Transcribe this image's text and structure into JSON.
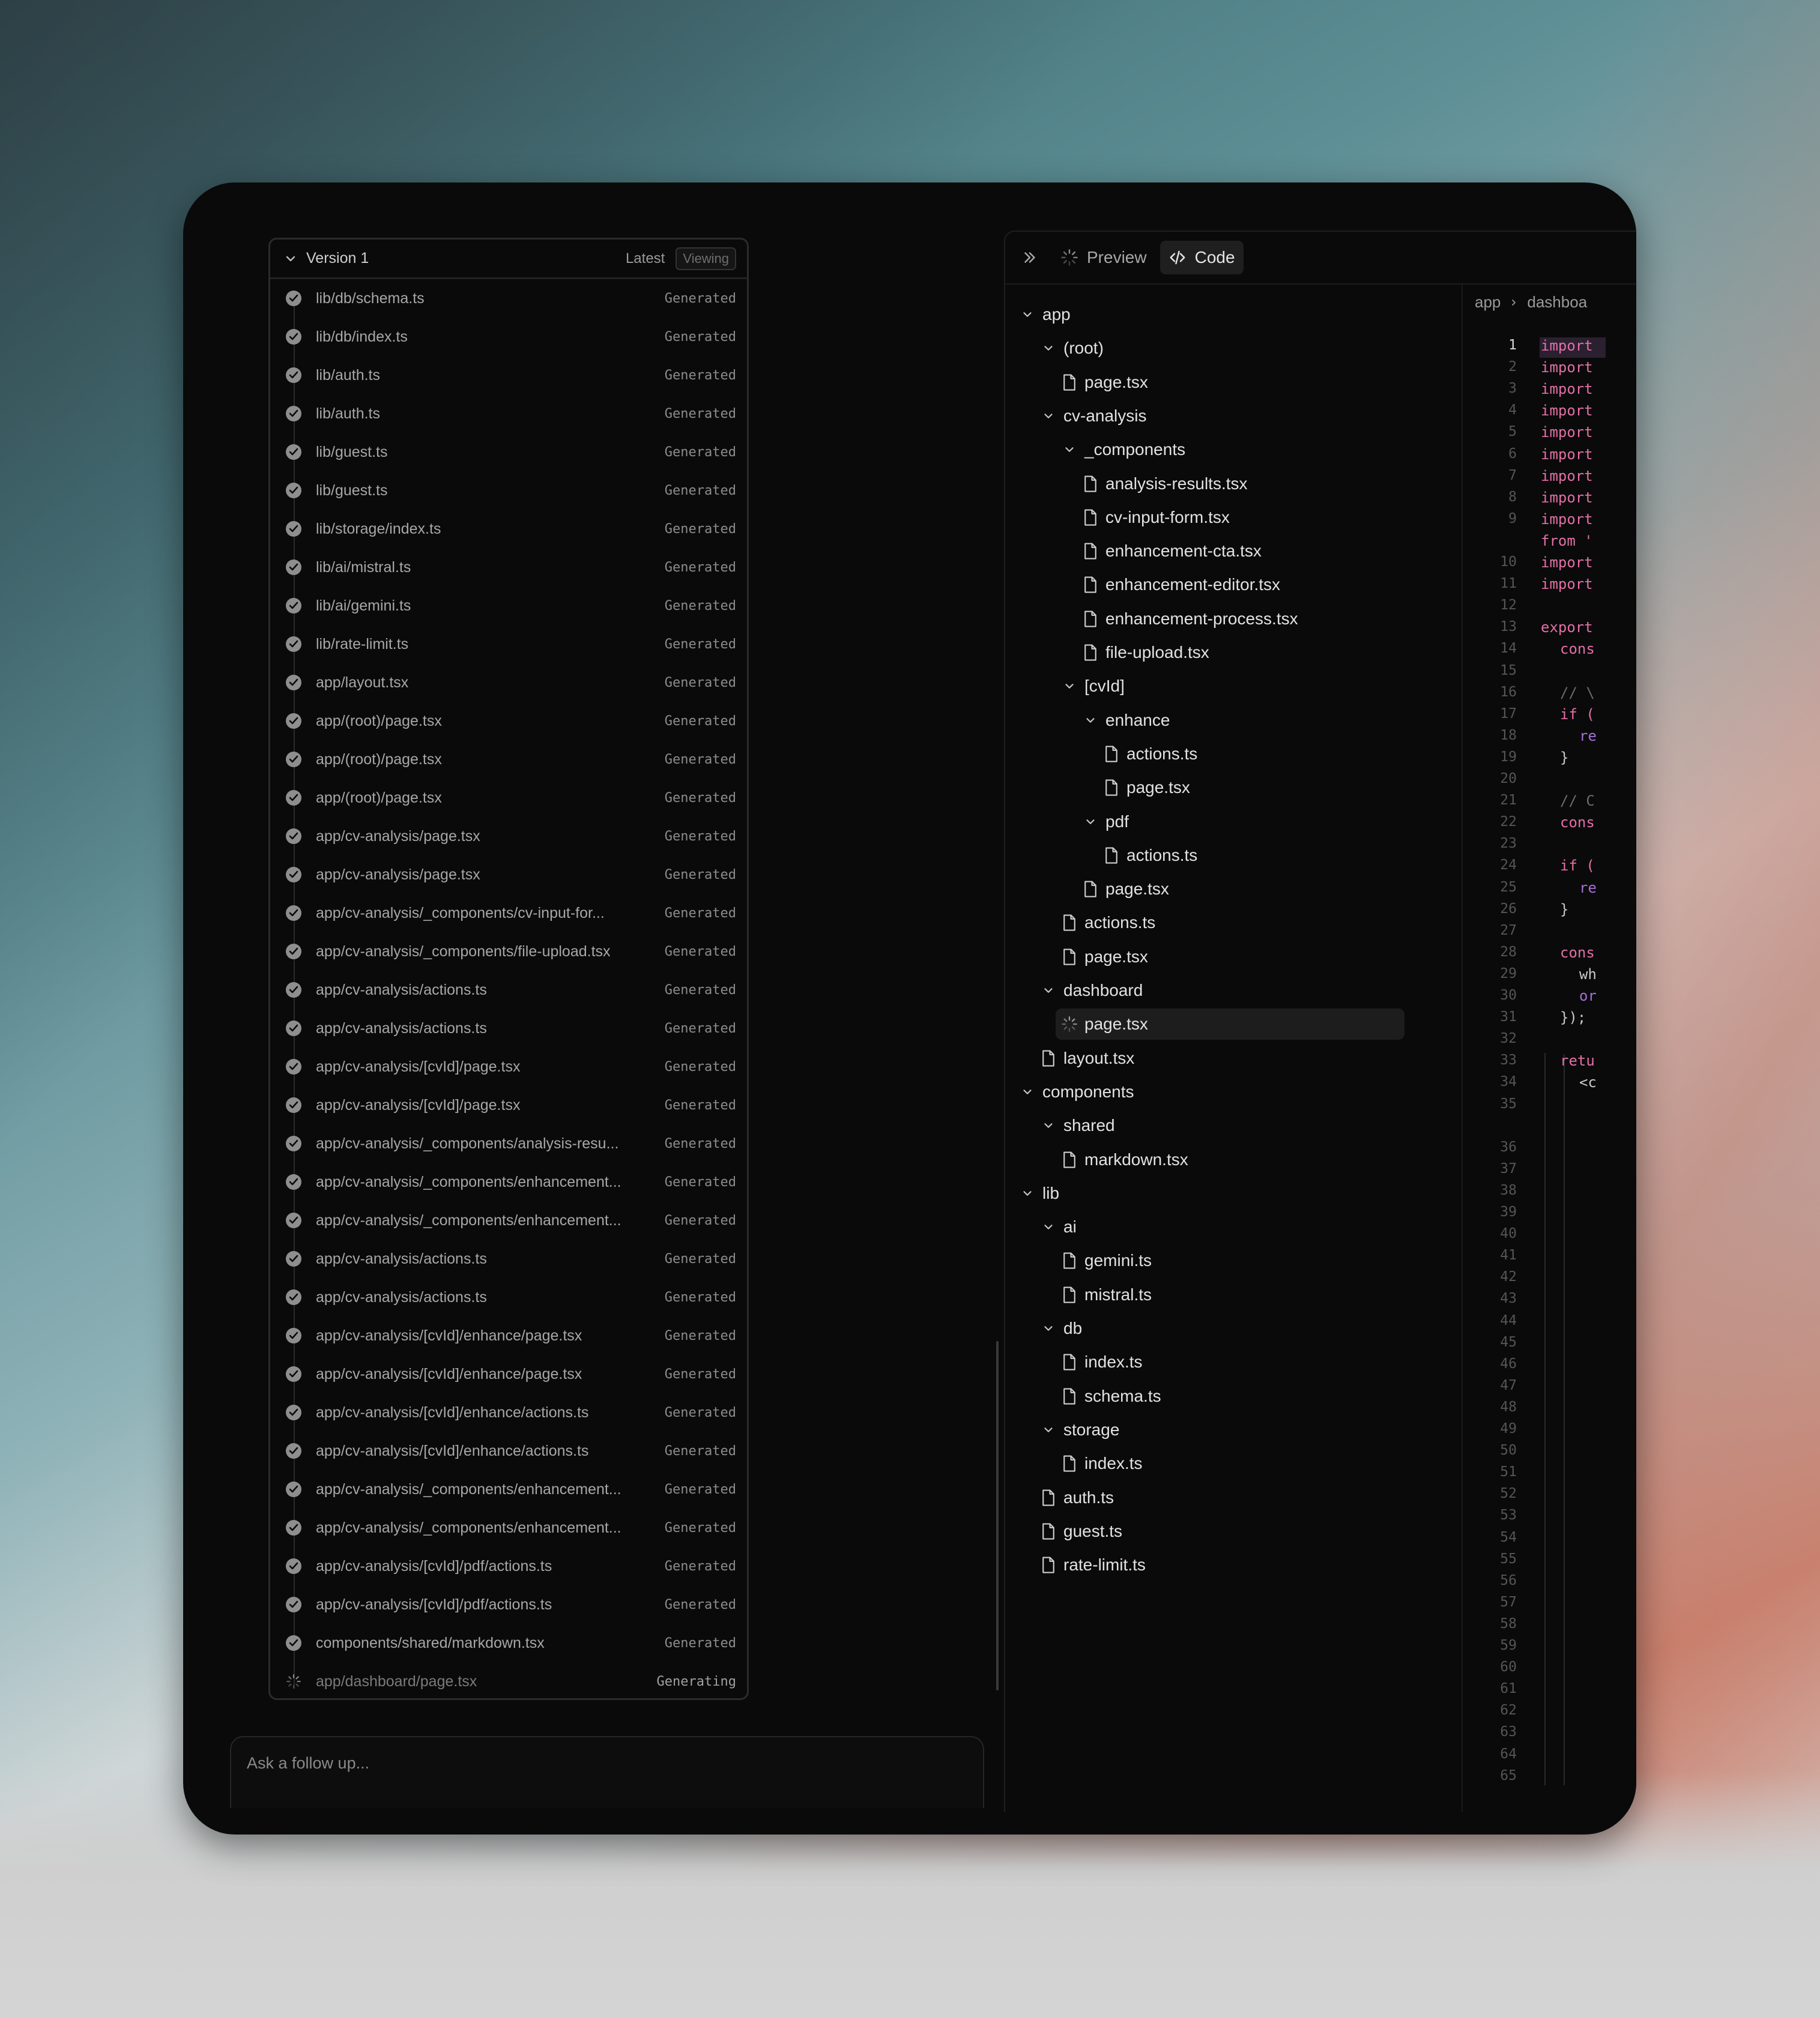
{
  "version_panel": {
    "title": "Version 1",
    "latest_label": "Latest",
    "viewing_label": "Viewing",
    "rows": [
      {
        "path": "lib/db/schema.ts",
        "status": "Generated"
      },
      {
        "path": "lib/db/index.ts",
        "status": "Generated"
      },
      {
        "path": "lib/auth.ts",
        "status": "Generated"
      },
      {
        "path": "lib/auth.ts",
        "status": "Generated"
      },
      {
        "path": "lib/guest.ts",
        "status": "Generated"
      },
      {
        "path": "lib/guest.ts",
        "status": "Generated"
      },
      {
        "path": "lib/storage/index.ts",
        "status": "Generated"
      },
      {
        "path": "lib/ai/mistral.ts",
        "status": "Generated"
      },
      {
        "path": "lib/ai/gemini.ts",
        "status": "Generated"
      },
      {
        "path": "lib/rate-limit.ts",
        "status": "Generated"
      },
      {
        "path": "app/layout.tsx",
        "status": "Generated"
      },
      {
        "path": "app/(root)/page.tsx",
        "status": "Generated"
      },
      {
        "path": "app/(root)/page.tsx",
        "status": "Generated"
      },
      {
        "path": "app/(root)/page.tsx",
        "status": "Generated"
      },
      {
        "path": "app/cv-analysis/page.tsx",
        "status": "Generated"
      },
      {
        "path": "app/cv-analysis/page.tsx",
        "status": "Generated"
      },
      {
        "path": "app/cv-analysis/_components/cv-input-for...",
        "status": "Generated"
      },
      {
        "path": "app/cv-analysis/_components/file-upload.tsx",
        "status": "Generated"
      },
      {
        "path": "app/cv-analysis/actions.ts",
        "status": "Generated"
      },
      {
        "path": "app/cv-analysis/actions.ts",
        "status": "Generated"
      },
      {
        "path": "app/cv-analysis/[cvId]/page.tsx",
        "status": "Generated"
      },
      {
        "path": "app/cv-analysis/[cvId]/page.tsx",
        "status": "Generated"
      },
      {
        "path": "app/cv-analysis/_components/analysis-resu...",
        "status": "Generated"
      },
      {
        "path": "app/cv-analysis/_components/enhancement...",
        "status": "Generated"
      },
      {
        "path": "app/cv-analysis/_components/enhancement...",
        "status": "Generated"
      },
      {
        "path": "app/cv-analysis/actions.ts",
        "status": "Generated"
      },
      {
        "path": "app/cv-analysis/actions.ts",
        "status": "Generated"
      },
      {
        "path": "app/cv-analysis/[cvId]/enhance/page.tsx",
        "status": "Generated"
      },
      {
        "path": "app/cv-analysis/[cvId]/enhance/page.tsx",
        "status": "Generated"
      },
      {
        "path": "app/cv-analysis/[cvId]/enhance/actions.ts",
        "status": "Generated"
      },
      {
        "path": "app/cv-analysis/[cvId]/enhance/actions.ts",
        "status": "Generated"
      },
      {
        "path": "app/cv-analysis/_components/enhancement...",
        "status": "Generated"
      },
      {
        "path": "app/cv-analysis/_components/enhancement...",
        "status": "Generated"
      },
      {
        "path": "app/cv-analysis/[cvId]/pdf/actions.ts",
        "status": "Generated"
      },
      {
        "path": "app/cv-analysis/[cvId]/pdf/actions.ts",
        "status": "Generated"
      },
      {
        "path": "components/shared/markdown.tsx",
        "status": "Generated"
      },
      {
        "path": "app/dashboard/page.tsx",
        "status": "Generating"
      }
    ]
  },
  "chat_input": {
    "placeholder": "Ask a follow up..."
  },
  "tabs": {
    "preview": "Preview",
    "code": "Code"
  },
  "file_tree": [
    {
      "name": "app",
      "type": "folder",
      "depth": 0
    },
    {
      "name": "(root)",
      "type": "folder",
      "depth": 1
    },
    {
      "name": "page.tsx",
      "type": "file",
      "depth": 2
    },
    {
      "name": "cv-analysis",
      "type": "folder",
      "depth": 1
    },
    {
      "name": "_components",
      "type": "folder",
      "depth": 2
    },
    {
      "name": "analysis-results.tsx",
      "type": "file",
      "depth": 3
    },
    {
      "name": "cv-input-form.tsx",
      "type": "file",
      "depth": 3
    },
    {
      "name": "enhancement-cta.tsx",
      "type": "file",
      "depth": 3
    },
    {
      "name": "enhancement-editor.tsx",
      "type": "file",
      "depth": 3
    },
    {
      "name": "enhancement-process.tsx",
      "type": "file",
      "depth": 3
    },
    {
      "name": "file-upload.tsx",
      "type": "file",
      "depth": 3
    },
    {
      "name": "[cvId]",
      "type": "folder",
      "depth": 2
    },
    {
      "name": "enhance",
      "type": "folder",
      "depth": 3
    },
    {
      "name": "actions.ts",
      "type": "file",
      "depth": 4
    },
    {
      "name": "page.tsx",
      "type": "file",
      "depth": 4
    },
    {
      "name": "pdf",
      "type": "folder",
      "depth": 3
    },
    {
      "name": "actions.ts",
      "type": "file",
      "depth": 4
    },
    {
      "name": "page.tsx",
      "type": "file",
      "depth": 3
    },
    {
      "name": "actions.ts",
      "type": "file",
      "depth": 2
    },
    {
      "name": "page.tsx",
      "type": "file",
      "depth": 2
    },
    {
      "name": "dashboard",
      "type": "folder",
      "depth": 1
    },
    {
      "name": "page.tsx",
      "type": "loading",
      "depth": 2,
      "selected": true
    },
    {
      "name": "layout.tsx",
      "type": "file",
      "depth": 1
    },
    {
      "name": "components",
      "type": "folder",
      "depth": 0
    },
    {
      "name": "shared",
      "type": "folder",
      "depth": 1
    },
    {
      "name": "markdown.tsx",
      "type": "file",
      "depth": 2
    },
    {
      "name": "lib",
      "type": "folder",
      "depth": 0
    },
    {
      "name": "ai",
      "type": "folder",
      "depth": 1
    },
    {
      "name": "gemini.ts",
      "type": "file",
      "depth": 2
    },
    {
      "name": "mistral.ts",
      "type": "file",
      "depth": 2
    },
    {
      "name": "db",
      "type": "folder",
      "depth": 1
    },
    {
      "name": "index.ts",
      "type": "file",
      "depth": 2
    },
    {
      "name": "schema.ts",
      "type": "file",
      "depth": 2
    },
    {
      "name": "storage",
      "type": "folder",
      "depth": 1
    },
    {
      "name": "index.ts",
      "type": "file",
      "depth": 2
    },
    {
      "name": "auth.ts",
      "type": "file",
      "depth": 1
    },
    {
      "name": "guest.ts",
      "type": "file",
      "depth": 1
    },
    {
      "name": "rate-limit.ts",
      "type": "file",
      "depth": 1
    }
  ],
  "breadcrumb": [
    "app",
    "dashboa"
  ],
  "line_numbers": [
    "1",
    "2",
    "3",
    "4",
    "5",
    "6",
    "7",
    "8",
    "9",
    "",
    "10",
    "11",
    "12",
    "13",
    "14",
    "15",
    "16",
    "17",
    "18",
    "19",
    "20",
    "21",
    "22",
    "23",
    "24",
    "25",
    "26",
    "27",
    "28",
    "29",
    "30",
    "31",
    "32",
    "33",
    "34",
    "35",
    "",
    "36",
    "37",
    "38",
    "39",
    "40",
    "41",
    "42",
    "43",
    "44",
    "45",
    "46",
    "47",
    "48",
    "49",
    "50",
    "51",
    "52",
    "53",
    "54",
    "55",
    "56",
    "57",
    "58",
    "59",
    "60",
    "61",
    "62",
    "63",
    "64",
    "65"
  ],
  "code_lines": [
    {
      "indent": 0,
      "text": "import",
      "cls": "kw"
    },
    {
      "indent": 0,
      "text": "import",
      "cls": "kw"
    },
    {
      "indent": 0,
      "text": "import",
      "cls": "kw"
    },
    {
      "indent": 0,
      "text": "import",
      "cls": "kw"
    },
    {
      "indent": 0,
      "text": "import",
      "cls": "kw"
    },
    {
      "indent": 0,
      "text": "import",
      "cls": "kw"
    },
    {
      "indent": 0,
      "text": "import",
      "cls": "kw"
    },
    {
      "indent": 0,
      "text": "import",
      "cls": "kw"
    },
    {
      "indent": 0,
      "text": "import",
      "cls": "kw"
    },
    {
      "indent": 0,
      "text": "from '",
      "cls": "kw"
    },
    {
      "indent": 0,
      "text": "import",
      "cls": "kw"
    },
    {
      "indent": 0,
      "text": "import",
      "cls": "kw"
    },
    {
      "indent": 0,
      "text": "",
      "cls": "id"
    },
    {
      "indent": 0,
      "text": "export",
      "cls": "kw"
    },
    {
      "indent": 1,
      "text": "cons",
      "cls": "kw"
    },
    {
      "indent": 0,
      "text": "",
      "cls": "id"
    },
    {
      "indent": 1,
      "text": "// \\",
      "cls": "cm"
    },
    {
      "indent": 1,
      "text": "if (",
      "cls": "kw"
    },
    {
      "indent": 2,
      "text": "re",
      "cls": "pu"
    },
    {
      "indent": 1,
      "text": "}",
      "cls": "id"
    },
    {
      "indent": 0,
      "text": "",
      "cls": "id"
    },
    {
      "indent": 1,
      "text": "// C",
      "cls": "cm"
    },
    {
      "indent": 1,
      "text": "cons",
      "cls": "kw"
    },
    {
      "indent": 0,
      "text": "",
      "cls": "id"
    },
    {
      "indent": 1,
      "text": "if (",
      "cls": "kw"
    },
    {
      "indent": 2,
      "text": "re",
      "cls": "pu"
    },
    {
      "indent": 1,
      "text": "}",
      "cls": "id"
    },
    {
      "indent": 0,
      "text": "",
      "cls": "id"
    },
    {
      "indent": 1,
      "text": "cons",
      "cls": "kw"
    },
    {
      "indent": 2,
      "text": "wh",
      "cls": "id"
    },
    {
      "indent": 2,
      "text": "or",
      "cls": "pu"
    },
    {
      "indent": 1,
      "text": "});",
      "cls": "id"
    },
    {
      "indent": 0,
      "text": "",
      "cls": "id"
    },
    {
      "indent": 1,
      "text": "retu",
      "cls": "kw"
    },
    {
      "indent": 2,
      "text": "<c",
      "cls": "id"
    }
  ]
}
